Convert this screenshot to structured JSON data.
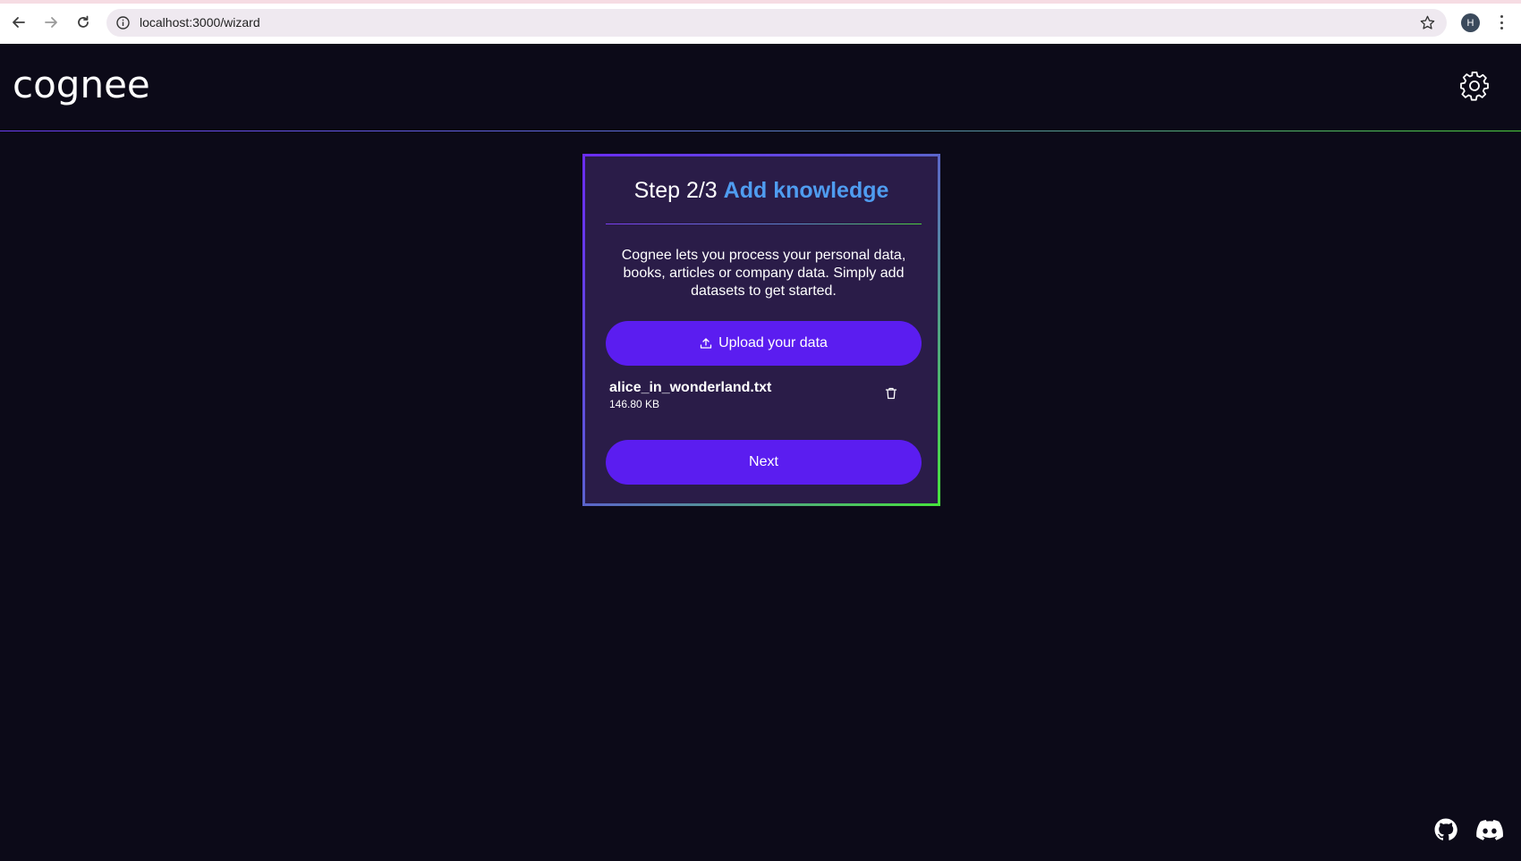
{
  "browser": {
    "url": "localhost:3000/wizard",
    "profile_initial": "H"
  },
  "header": {
    "logo_text": "cognee"
  },
  "wizard": {
    "step_label": "Step 2/3",
    "title_accent": "Add knowledge",
    "description": "Cognee lets you process your personal data, books, articles or company data. Simply add datasets to get started.",
    "upload_label": "Upload your data",
    "file": {
      "name": "alice_in_wonderland.txt",
      "size": "146.80 KB"
    },
    "next_label": "Next"
  },
  "colors": {
    "background": "#0c0a18",
    "card": "#2a1c48",
    "button": "#5b1df0",
    "title_accent": "#4f9cf0",
    "gradient_start": "#6a2cf2",
    "gradient_end": "#47e43c"
  }
}
